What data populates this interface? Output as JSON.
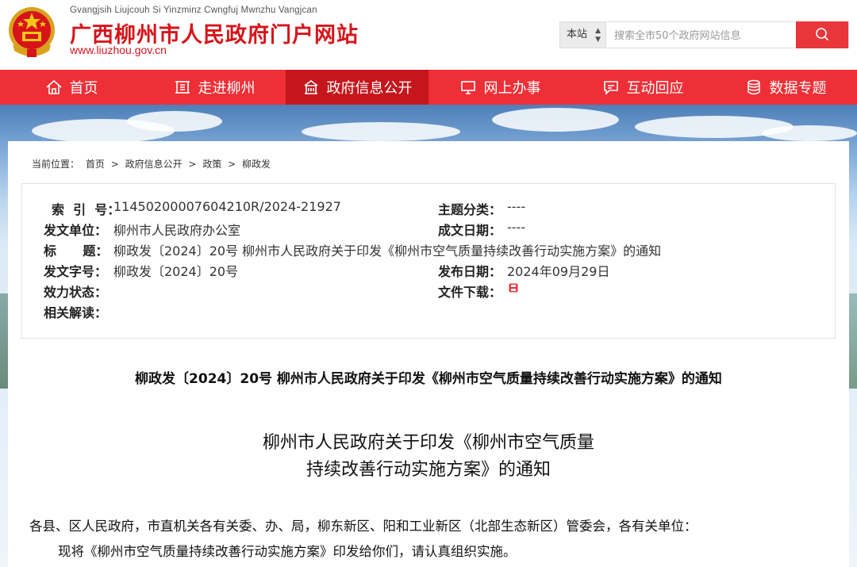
{
  "header": {
    "pinyin": "Gvangjsih Liujcouh Si Yinzminz Cwngfuj Mwnzhu Vangjcan",
    "title": "广西柳州市人民政府门户网站",
    "url": "www.liuzhou.gov.cn",
    "emblem_icon": "national-emblem",
    "brand_color": "#d7141a"
  },
  "search": {
    "scope": "本站",
    "placeholder": "搜索全市50个政府网站信息",
    "button_icon": "search-icon"
  },
  "nav": {
    "items": [
      {
        "label": "首页",
        "icon": "home-icon"
      },
      {
        "label": "走进柳州",
        "icon": "city-icon"
      },
      {
        "label": "政府信息公开",
        "icon": "building-icon",
        "active": true
      },
      {
        "label": "网上办事",
        "icon": "computer-icon"
      },
      {
        "label": "互动回应",
        "icon": "chat-icon"
      },
      {
        "label": "数据专题",
        "icon": "database-icon"
      }
    ],
    "color": "#ee2f37",
    "active_color": "#c4161c"
  },
  "breadcrumb": {
    "prefix": "当前位置：",
    "items": [
      "首页",
      "政府信息公开",
      "政策",
      "柳政发"
    ],
    "separator": ">"
  },
  "meta": {
    "index_label": "索  引  号：",
    "index_value": "11450200007604210R/2024-21927",
    "topic_label": "主题分类：",
    "topic_value": "----",
    "issuer_label": "发文单位：",
    "issuer_value": "柳州市人民政府办公室",
    "created_label": "成文日期：",
    "created_value": "----",
    "title_label": "标      题：",
    "title_value": "柳政发〔2024〕20号 柳州市人民政府关于印发《柳州市空气质量持续改善行动实施方案》的通知",
    "docno_label": "发文字号：",
    "docno_value": "柳政发〔2024〕20号",
    "pubdate_label": "发布日期：",
    "pubdate_value": "2024年09月29日",
    "status_label": "效力状态：",
    "download_label": "文件下载：",
    "download_icon": "pdf-file-icon",
    "interp_label": "相关解读："
  },
  "doc": {
    "heading": "柳政发〔2024〕20号 柳州市人民政府关于印发《柳州市空气质量持续改善行动实施方案》的通知",
    "title_line1": "柳州市人民政府关于印发《柳州市空气质量",
    "title_line2": "持续改善行动实施方案》的通知",
    "recipients": "各县、区人民政府，市直机关各有关委、办、局，柳东新区、阳和工业新区（北部生态新区）管委会，各有关单位：",
    "para1": "现将《柳州市空气质量持续改善行动实施方案》印发给你们，请认真组织实施。"
  }
}
